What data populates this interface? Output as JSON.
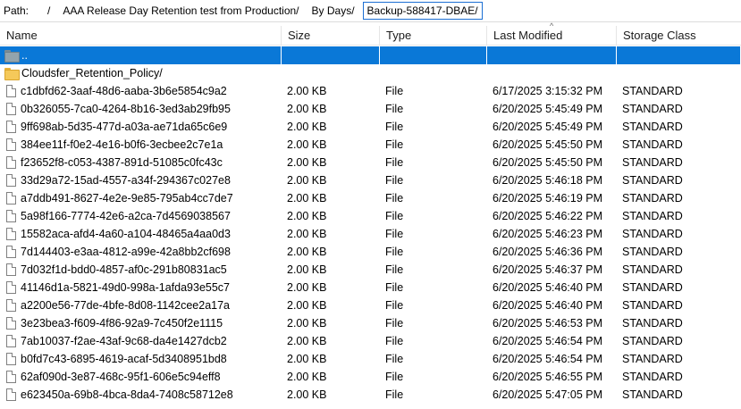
{
  "path": {
    "label": "Path:",
    "crumbs": [
      "/",
      "AAA Release Day Retention test from Production/",
      "By Days/",
      "Backup-588417-DBAE/"
    ]
  },
  "columns": {
    "name": "Name",
    "size": "Size",
    "type": "Type",
    "modified": "Last Modified",
    "storage": "Storage Class"
  },
  "sort_indicator": "^",
  "parent_row": {
    "name": ".."
  },
  "folders": [
    {
      "name": "Cloudsfer_Retention_Policy/"
    }
  ],
  "files": [
    {
      "name": "c1dbfd62-3aaf-48d6-aaba-3b6e5854c9a2",
      "size": "2.00 KB",
      "type": "File",
      "modified": "6/17/2025 3:15:32 PM",
      "storage": "STANDARD"
    },
    {
      "name": "0b326055-7ca0-4264-8b16-3ed3ab29fb95",
      "size": "2.00 KB",
      "type": "File",
      "modified": "6/20/2025 5:45:49 PM",
      "storage": "STANDARD"
    },
    {
      "name": "9ff698ab-5d35-477d-a03a-ae71da65c6e9",
      "size": "2.00 KB",
      "type": "File",
      "modified": "6/20/2025 5:45:49 PM",
      "storage": "STANDARD"
    },
    {
      "name": "384ee11f-f0e2-4e16-b0f6-3ecbee2c7e1a",
      "size": "2.00 KB",
      "type": "File",
      "modified": "6/20/2025 5:45:50 PM",
      "storage": "STANDARD"
    },
    {
      "name": "f23652f8-c053-4387-891d-51085c0fc43c",
      "size": "2.00 KB",
      "type": "File",
      "modified": "6/20/2025 5:45:50 PM",
      "storage": "STANDARD"
    },
    {
      "name": "33d29a72-15ad-4557-a34f-294367c027e8",
      "size": "2.00 KB",
      "type": "File",
      "modified": "6/20/2025 5:46:18 PM",
      "storage": "STANDARD"
    },
    {
      "name": "a7ddb491-8627-4e2e-9e85-795ab4cc7de7",
      "size": "2.00 KB",
      "type": "File",
      "modified": "6/20/2025 5:46:19 PM",
      "storage": "STANDARD"
    },
    {
      "name": "5a98f166-7774-42e6-a2ca-7d4569038567",
      "size": "2.00 KB",
      "type": "File",
      "modified": "6/20/2025 5:46:22 PM",
      "storage": "STANDARD"
    },
    {
      "name": "15582aca-afd4-4a60-a104-48465a4aa0d3",
      "size": "2.00 KB",
      "type": "File",
      "modified": "6/20/2025 5:46:23 PM",
      "storage": "STANDARD"
    },
    {
      "name": "7d144403-e3aa-4812-a99e-42a8bb2cf698",
      "size": "2.00 KB",
      "type": "File",
      "modified": "6/20/2025 5:46:36 PM",
      "storage": "STANDARD"
    },
    {
      "name": "7d032f1d-bdd0-4857-af0c-291b80831ac5",
      "size": "2.00 KB",
      "type": "File",
      "modified": "6/20/2025 5:46:37 PM",
      "storage": "STANDARD"
    },
    {
      "name": "41146d1a-5821-49d0-998a-1afda93e55c7",
      "size": "2.00 KB",
      "type": "File",
      "modified": "6/20/2025 5:46:40 PM",
      "storage": "STANDARD"
    },
    {
      "name": "a2200e56-77de-4bfe-8d08-1142cee2a17a",
      "size": "2.00 KB",
      "type": "File",
      "modified": "6/20/2025 5:46:40 PM",
      "storage": "STANDARD"
    },
    {
      "name": "3e23bea3-f609-4f86-92a9-7c450f2e1115",
      "size": "2.00 KB",
      "type": "File",
      "modified": "6/20/2025 5:46:53 PM",
      "storage": "STANDARD"
    },
    {
      "name": "7ab10037-f2ae-43af-9c68-da4e1427dcb2",
      "size": "2.00 KB",
      "type": "File",
      "modified": "6/20/2025 5:46:54 PM",
      "storage": "STANDARD"
    },
    {
      "name": "b0fd7c43-6895-4619-acaf-5d3408951bd8",
      "size": "2.00 KB",
      "type": "File",
      "modified": "6/20/2025 5:46:54 PM",
      "storage": "STANDARD"
    },
    {
      "name": "62af090d-3e87-468c-95f1-606e5c94eff8",
      "size": "2.00 KB",
      "type": "File",
      "modified": "6/20/2025 5:46:55 PM",
      "storage": "STANDARD"
    },
    {
      "name": "e623450a-69b8-4bca-8da4-7408c58712e8",
      "size": "2.00 KB",
      "type": "File",
      "modified": "6/20/2025 5:47:05 PM",
      "storage": "STANDARD"
    }
  ],
  "colors": {
    "selection": "#0a78d7",
    "crumb_border": "#1c6fd3",
    "folder": "#f5c95a"
  }
}
